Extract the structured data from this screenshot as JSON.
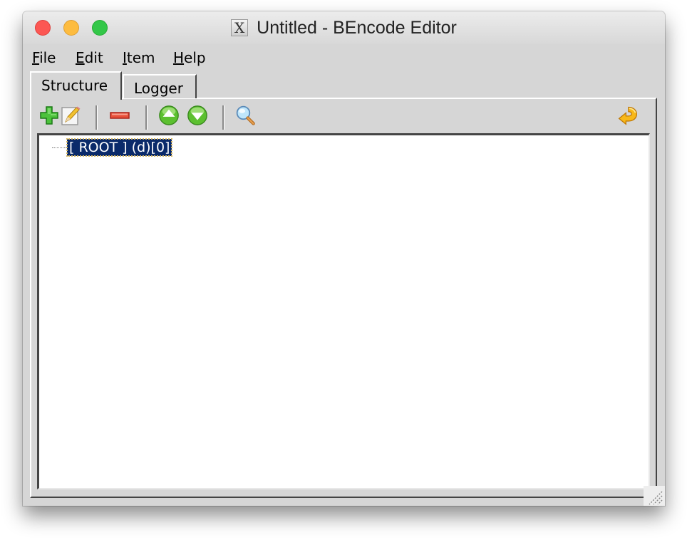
{
  "window": {
    "title": "Untitled - BEncode Editor",
    "app_icon": "X",
    "traffic_lights": {
      "close": "#fc5753",
      "minimize": "#fdbc40",
      "zoom": "#33c748"
    }
  },
  "menubar": {
    "items": [
      {
        "label": "File",
        "mnemonic": "F"
      },
      {
        "label": "Edit",
        "mnemonic": "E"
      },
      {
        "label": "Item",
        "mnemonic": "I"
      },
      {
        "label": "Help",
        "mnemonic": "H"
      }
    ]
  },
  "tabs": [
    {
      "label": "Structure",
      "active": true
    },
    {
      "label": "Logger",
      "active": false
    }
  ],
  "toolbar": {
    "buttons": [
      {
        "name": "add",
        "icon": "plus-icon"
      },
      {
        "name": "edit",
        "icon": "pencil-icon"
      },
      {
        "name": "remove",
        "icon": "minus-icon"
      },
      {
        "name": "move-up",
        "icon": "arrow-up-icon"
      },
      {
        "name": "move-down",
        "icon": "arrow-down-icon"
      },
      {
        "name": "search",
        "icon": "magnifier-icon"
      },
      {
        "name": "undo",
        "icon": "undo-arrow-icon"
      }
    ]
  },
  "tree": {
    "root_label": "[ ROOT ] (d)[0]",
    "selected_color": "#0a2a6a"
  }
}
